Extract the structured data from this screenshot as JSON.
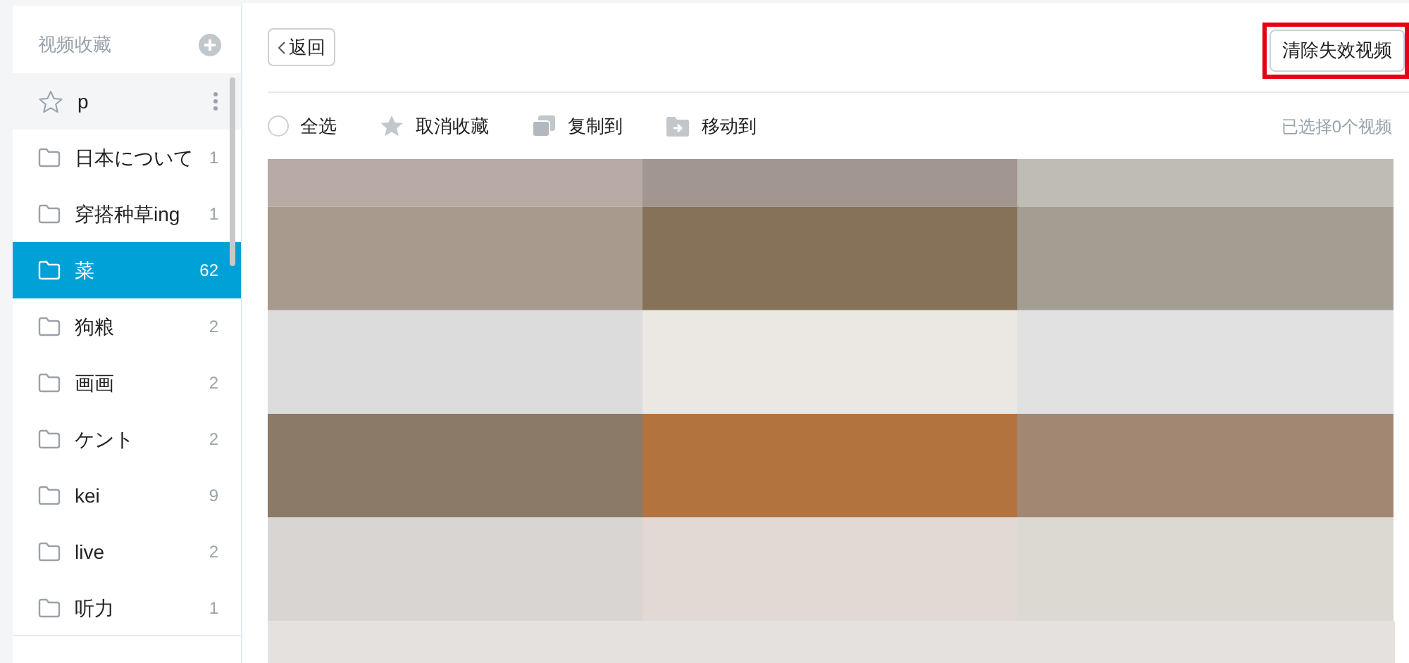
{
  "sidebar": {
    "title": "视频收藏",
    "folders": [
      {
        "kind": "default",
        "name": "p",
        "selected": false
      },
      {
        "kind": "folder",
        "name": "日本について",
        "count": "1",
        "selected": false
      },
      {
        "kind": "folder",
        "name": "穿搭种草ing",
        "count": "1",
        "selected": false
      },
      {
        "kind": "folder",
        "name": "菜",
        "count": "62",
        "selected": true
      },
      {
        "kind": "folder",
        "name": "狗粮",
        "count": "2",
        "selected": false
      },
      {
        "kind": "folder",
        "name": "画画",
        "count": "2",
        "selected": false
      },
      {
        "kind": "folder",
        "name": "ケント",
        "count": "2",
        "selected": false
      },
      {
        "kind": "folder",
        "name": "kei",
        "count": "9",
        "selected": false
      },
      {
        "kind": "folder",
        "name": "live",
        "count": "2",
        "selected": false
      },
      {
        "kind": "folder",
        "name": "听力",
        "count": "1",
        "selected": false
      }
    ]
  },
  "header": {
    "back_button": "返回",
    "clear_button": "清除失效视频"
  },
  "toolbar": {
    "select_all": {
      "label": "全选",
      "checked": false
    },
    "actions": [
      {
        "kind": "unfavorite",
        "label": "取消收藏"
      },
      {
        "kind": "copy",
        "label": "复制到"
      },
      {
        "kind": "move",
        "label": "移动到"
      }
    ],
    "selection_count": "已选择0个视频"
  }
}
